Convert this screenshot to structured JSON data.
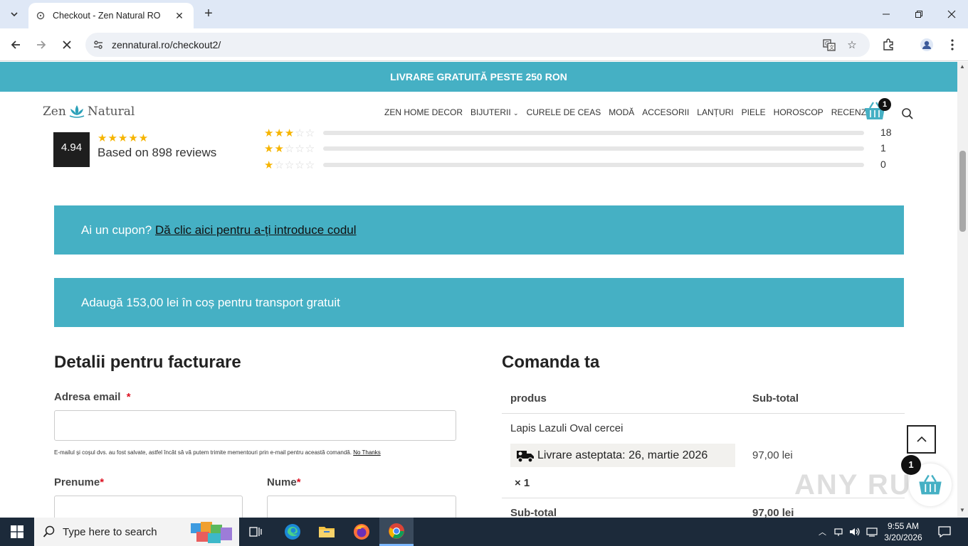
{
  "browser": {
    "tab_title": "Checkout - Zen Natural RO",
    "url": "zennatural.ro/checkout2/"
  },
  "site": {
    "promo": "LIVRARE GRATUITĂ PESTE 250 RON",
    "logo_left": "Zen",
    "logo_right": "Natural",
    "nav": [
      "ZEN HOME DECOR",
      "BIJUTERII",
      "CURELE DE CEAS",
      "MODĂ",
      "ACCESORII",
      "LANȚURI",
      "PIELE",
      "HOROSCOP",
      "RECENZIILE"
    ],
    "cart_count": "1"
  },
  "reviews": {
    "average": "4.94",
    "based_on": "Based on 898 reviews",
    "rows": [
      {
        "stars": 3,
        "count": "18"
      },
      {
        "stars": 2,
        "count": "1"
      },
      {
        "stars": 1,
        "count": "0"
      }
    ]
  },
  "coupon": {
    "prompt": "Ai un cupon?",
    "link": "Dă clic aici pentru a-ți introduce codul"
  },
  "free_shipping": "Adaugă 153,00 lei în coș pentru transport gratuit",
  "billing": {
    "title": "Detalii pentru facturare",
    "email_label": "Adresa email",
    "req_mark": "*",
    "email_note": "E-mailul și coșul dvs. au fost salvate, astfel încât să vă putem trimite mementouri prin e-mail pentru această comandă.",
    "no_thanks": "No Thanks",
    "first_name_label": "Prenume",
    "last_name_label": "Nume"
  },
  "order": {
    "title": "Comanda ta",
    "col_product": "produs",
    "col_subtotal": "Sub-total",
    "product_name": "Lapis Lazuli Oval cercei",
    "delivery": "Livrare asteptata: 26, martie 2026",
    "qty": "× 1",
    "price": "97,00 lei",
    "subtotal_label": "Sub-total",
    "subtotal_value": "97,00 lei"
  },
  "floating_cart_count": "1",
  "watermark": "ANY RUN",
  "taskbar": {
    "search_placeholder": "Type here to search",
    "time": "9:55 AM",
    "date": "3/20/2026"
  },
  "colors": {
    "accent": "#45b0c4",
    "star": "#f6b400",
    "taskbar": "#1c2a3a"
  }
}
